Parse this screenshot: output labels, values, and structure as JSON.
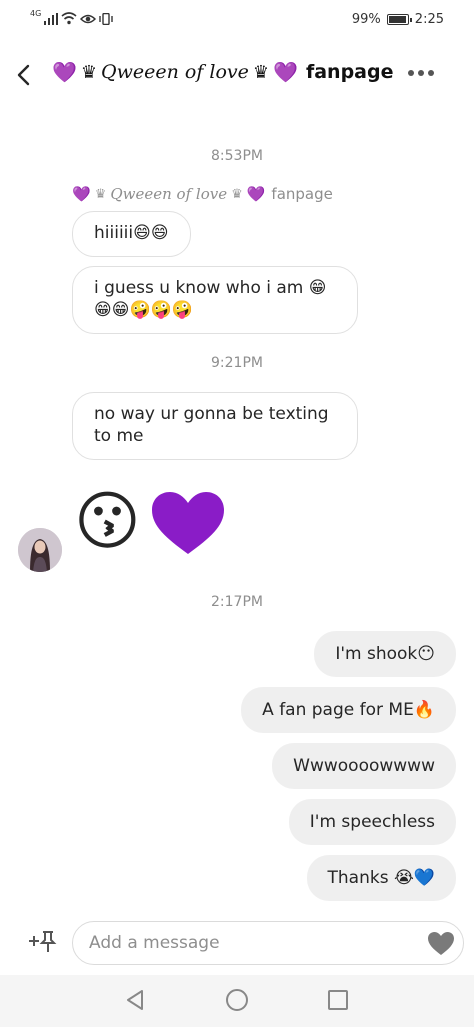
{
  "status_bar": {
    "network": "4G",
    "battery": "99%",
    "battery_level": 0.99,
    "time": "2:25"
  },
  "header": {
    "title_script": "Qweeen of love",
    "title_suffix": "fanpage",
    "heart_glyph": "💜",
    "crown_glyph": "♛"
  },
  "sender": {
    "name_script": "Qweeen of love",
    "name_suffix": "fanpage"
  },
  "timestamps": [
    "8:53PM",
    "9:21PM",
    "2:17PM"
  ],
  "incoming_messages": [
    {
      "text": "hiiiiii😄😄"
    },
    {
      "text": "i guess u know who i am 😁 😁😁🤪🤪🤪"
    },
    {
      "text": "no way ur gonna be texting to me"
    }
  ],
  "incoming_reaction": {
    "emoji": "😗",
    "heart_color": "#8a1cc7"
  },
  "outgoing_messages": [
    {
      "text": "I'm shook😶"
    },
    {
      "text": "A fan page for ME🔥"
    },
    {
      "text": "Wwwoooowwww"
    },
    {
      "text": "I'm speechless"
    },
    {
      "text": "Thanks 😭💙"
    }
  ],
  "composer": {
    "placeholder": "Add a message"
  },
  "colors": {
    "accent_purple": "#8a1cc7",
    "outgoing_bubble": "#efefef",
    "incoming_border": "#e0e0e0",
    "muted_text": "#8e8e8e"
  }
}
